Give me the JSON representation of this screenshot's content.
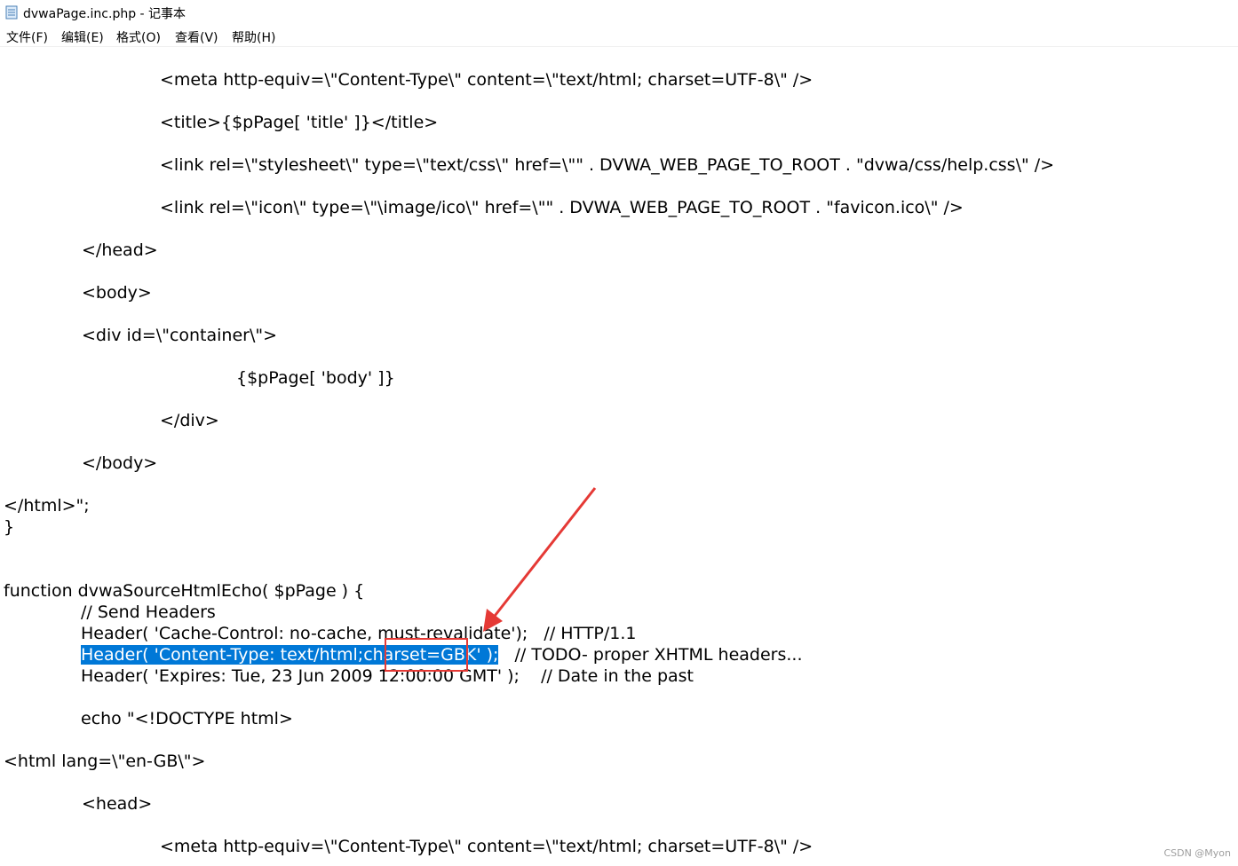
{
  "window": {
    "title": "dvwaPage.inc.php - 记事本"
  },
  "menu": {
    "file": "文件(F)",
    "edit": "编辑(E)",
    "format": "格式(O)",
    "view": "查看(V)",
    "help": "帮助(H)"
  },
  "editor": {
    "lines": [
      "<meta http-equiv=\\\"Content-Type\\\" content=\\\"text/html; charset=UTF-8\\\" />",
      "<title>{$pPage[ 'title' ]}</title>",
      "<link rel=\\\"stylesheet\\\" type=\\\"text/css\\\" href=\\\"\" . DVWA_WEB_PAGE_TO_ROOT . \"dvwa/css/help.css\\\" />",
      "<link rel=\\\"icon\\\" type=\\\"\\image/ico\\\" href=\\\"\" . DVWA_WEB_PAGE_TO_ROOT . \"favicon.ico\\\" />",
      "</head>",
      "<body>",
      "<div id=\\\"container\\\">",
      "{$pPage[ 'body' ]}",
      "</div>",
      "</body>",
      "</html>\";",
      "}",
      "function dvwaSourceHtmlEcho( $pPage ) {",
      "// Send Headers",
      "Header( 'Cache-Control: no-cache, must-revalidate');   // HTTP/1.1",
      "Header( 'Content-Type: text/html;charset=GBK' );",
      "   // TODO- proper XHTML headers...",
      "Header( 'Expires: Tue, 23 Jun 2009 12:00:00 GMT' );    // Date in the past",
      "echo \"<!DOCTYPE html>",
      "<html lang=\\\"en-GB\\\">",
      "<head>",
      "<meta http-equiv=\\\"Content-Type\\\" content=\\\"text/html; charset=UTF-8\\\" />"
    ]
  },
  "annotation": {
    "highlight": "charset=GBK",
    "color": "#e53935"
  },
  "watermark": "CSDN @Myon⁠"
}
